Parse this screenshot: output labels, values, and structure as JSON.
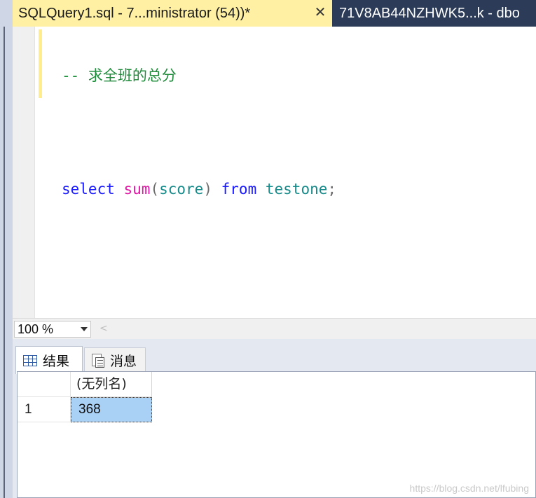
{
  "tabs": {
    "active_label": "SQLQuery1.sql - 7...ministrator (54))*",
    "close_glyph": "✕",
    "inactive_label": "71V8AB44NZHWK5...k - dbo"
  },
  "editor": {
    "line1": "-- 求全班的总分",
    "tokens": {
      "select": "select",
      "func": "sum",
      "paren_open": "(",
      "arg": "score",
      "paren_close": ")",
      "from": "from",
      "table": "testone",
      "semicolon": ";"
    }
  },
  "zoom": {
    "value": "100 %",
    "scroll_left_glyph": "<"
  },
  "results": {
    "tab_results": "结果",
    "tab_messages": "消息",
    "column_header": "(无列名)",
    "rows": [
      {
        "rownum": "1",
        "value": "368"
      }
    ]
  },
  "watermark": "https://blog.csdn.net/lfubing",
  "colors": {
    "tab_active_bg": "#fff0a3",
    "tab_strip_bg": "#2b3b58",
    "comment": "#1e8c3a",
    "keyword": "#1a1aff",
    "function": "#e316a6",
    "identifier": "#178a8a",
    "selected_cell": "#a9d0f5"
  }
}
